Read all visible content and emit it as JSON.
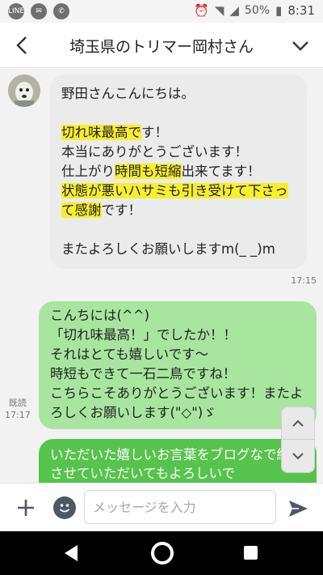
{
  "status_bar": {
    "left_icons": [
      "LINE",
      "chat-icon",
      "phone-icon"
    ],
    "line_label": "LINE",
    "battery_percent": "50%",
    "time": "8:31"
  },
  "header": {
    "title": "埼玉県のトリマー岡村さん"
  },
  "messages": {
    "incoming": {
      "greeting": "野田さんこんにちは。",
      "l1_hl": "切れ味最高で",
      "l1_rest": "す！",
      "l2": "本当にありがとうございます！",
      "l3_a": "仕上がり",
      "l3_hl": "時間も短縮",
      "l3_b": "出来てます！",
      "l4_hl": "状態が悪いハサミも引き受けて下さって感謝",
      "l4_rest": "です！",
      "closing": "またよろしくお願いしますm(_ _)m",
      "time": "17:15"
    },
    "outgoing1": {
      "lines": [
        "こんちには(^^)",
        "「切れ味最高！」でしたか！！",
        "それはとても嬉しいです〜",
        "時短もできて一石二鳥ですね！",
        "こちらこそありがとうございます！またよろしくお願いします(\"◇\")ゞ"
      ],
      "read_label": "既読",
      "time": "17:17"
    },
    "outgoing2": {
      "text": "いただいた嬉しいお言葉をブログなで紹介させていただいてもよろしいで"
    }
  },
  "input": {
    "placeholder": "メッセージを入力"
  },
  "colors": {
    "incoming_bubble": "#ebebeb",
    "outgoing_bubble": "#a8e6a0",
    "outgoing_bubble_dark": "#56c44c",
    "highlight": "#f7ef2c"
  }
}
